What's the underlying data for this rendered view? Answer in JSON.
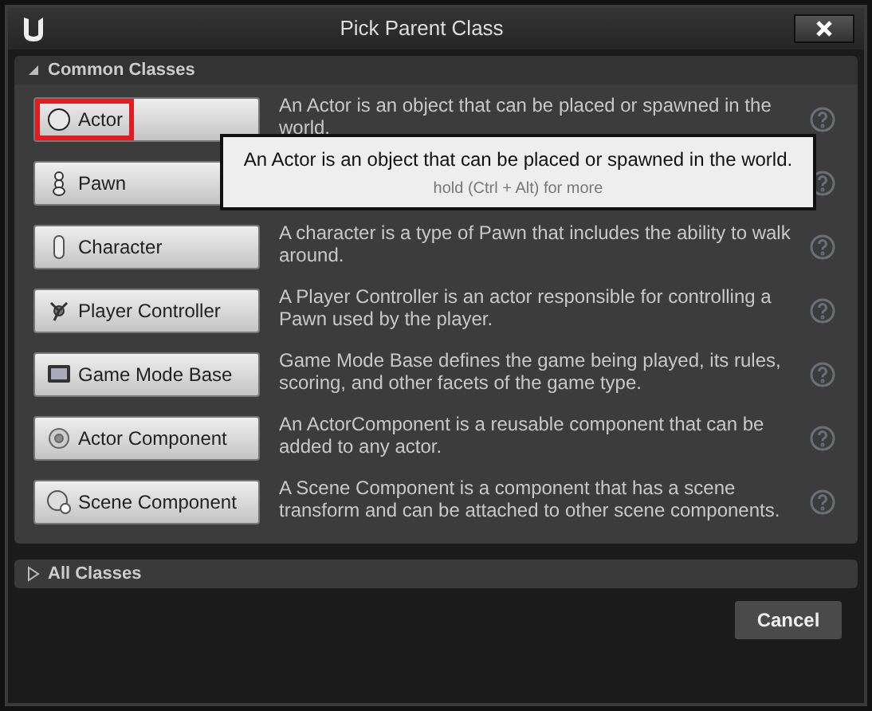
{
  "window": {
    "title": "Pick Parent Class"
  },
  "common_section": {
    "label": "Common Classes",
    "expanded": true
  },
  "classes": [
    {
      "name": "Actor",
      "description": "An Actor is an object that can be placed or spawned in the world.",
      "highlighted": true
    },
    {
      "name": "Pawn",
      "highlighted": false
    },
    {
      "name": "Character",
      "description": "A character is a type of Pawn that includes the ability to walk around.",
      "highlighted": false
    },
    {
      "name": "Player Controller",
      "description": "A Player Controller is an actor responsible for controlling a Pawn used by the player.",
      "highlighted": false
    },
    {
      "name": "Game Mode Base",
      "description": "Game Mode Base defines the game being played, its rules, scoring, and other facets of the game type.",
      "highlighted": false
    },
    {
      "name": "Actor Component",
      "description": "An ActorComponent is a reusable component that can be added to any actor.",
      "highlighted": false
    },
    {
      "name": "Scene Component",
      "description": "A Scene Component is a component that has a scene transform and can be attached to other scene components.",
      "highlighted": false
    }
  ],
  "tooltip": {
    "text": "An Actor is an object that can be placed or spawned in the world.",
    "hint": "hold (Ctrl + Alt) for more"
  },
  "all_section": {
    "label": "All Classes",
    "expanded": false
  },
  "buttons": {
    "cancel": "Cancel"
  }
}
